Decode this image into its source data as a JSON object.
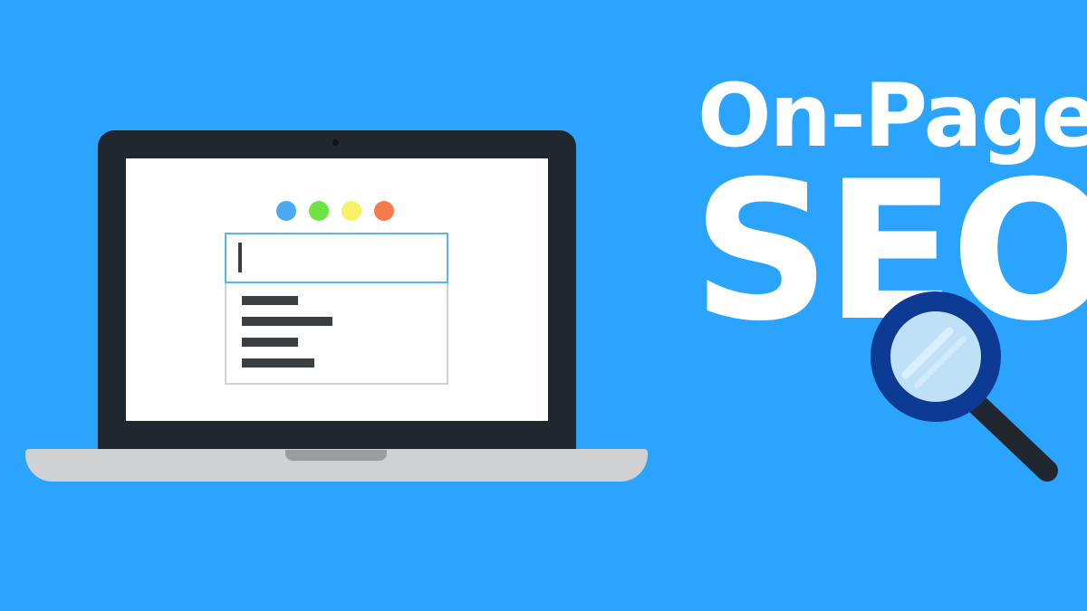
{
  "title": {
    "line1": "On-Page",
    "line2": "SEO"
  },
  "colors": {
    "background": "#2ba4ff",
    "laptop_bezel": "#20272e",
    "laptop_base": "#cfd1d3",
    "base_notch": "#9a9c9e",
    "screen": "#ffffff",
    "text_white": "#ffffff",
    "dot_blue": "#4aa9f0",
    "dot_green": "#6ee346",
    "dot_yellow": "#f9f06a",
    "dot_orange": "#f57b4a",
    "bar_dark": "#3c3f42",
    "magnifier_ring": "#0d3b94",
    "magnifier_glass": "#bfe1f8",
    "magnifier_handle": "#20272e"
  },
  "window_dots": [
    "blue",
    "green",
    "yellow",
    "orange"
  ],
  "icons": {
    "magnifier": "magnifying-glass-icon",
    "laptop": "laptop-icon"
  }
}
